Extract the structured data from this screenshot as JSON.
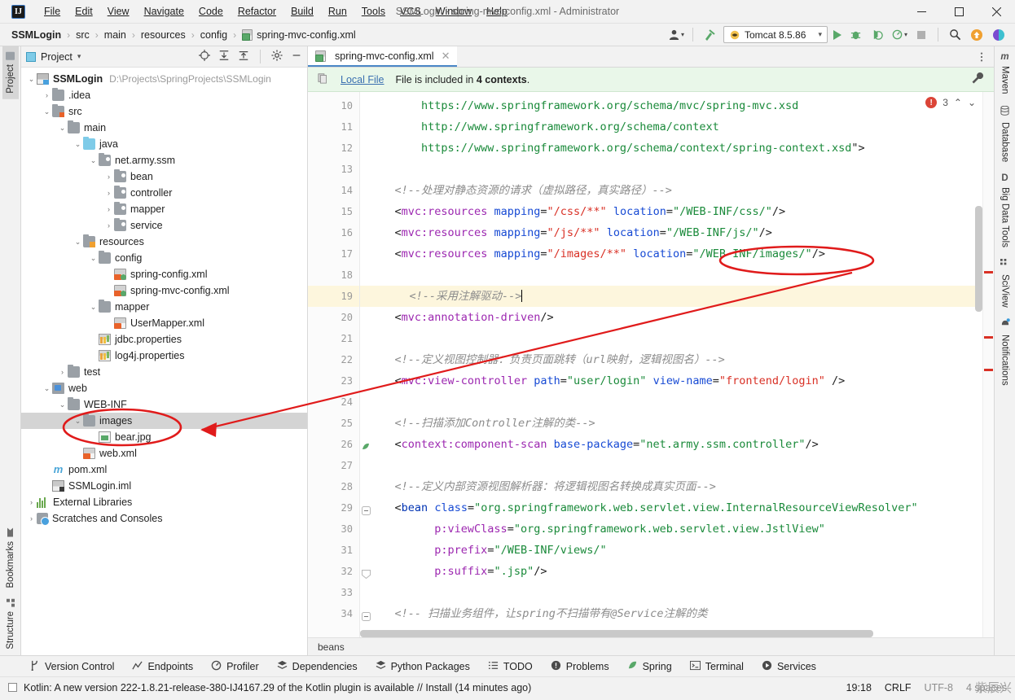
{
  "window": {
    "title": "SSMLogin - spring-mvc-config.xml - Administrator",
    "logo_text": "IJ",
    "minimize": "─",
    "maximize": "☐",
    "close": "✕"
  },
  "menu": {
    "items": [
      "File",
      "Edit",
      "View",
      "Navigate",
      "Code",
      "Refactor",
      "Build",
      "Run",
      "Tools",
      "VCS",
      "Window",
      "Help"
    ]
  },
  "navbar": {
    "crumbs": [
      "SSMLogin",
      "src",
      "main",
      "resources",
      "config",
      "spring-mvc-config.xml"
    ],
    "separator": "›",
    "run_config": "Tomcat 8.5.86",
    "caret": "▾"
  },
  "left_rail": {
    "top": [
      "Project"
    ],
    "bottom": [
      "Bookmarks",
      "Structure"
    ]
  },
  "right_rail": {
    "items": [
      "Maven",
      "Database",
      "Big Data Tools",
      "SciView",
      "Notifications"
    ]
  },
  "project": {
    "title": "Project",
    "caret": "▾",
    "tree": [
      {
        "depth": 0,
        "arrow": "⌄",
        "icon": "module-icon",
        "label": "SSMLogin",
        "bold": true,
        "path": "D:\\Projects\\SpringProjects\\SSMLogin"
      },
      {
        "depth": 1,
        "arrow": "›",
        "icon": "folder-icon",
        "label": ".idea"
      },
      {
        "depth": 1,
        "arrow": "⌄",
        "icon": "folder-source-icon",
        "label": "src"
      },
      {
        "depth": 2,
        "arrow": "⌄",
        "icon": "folder-icon",
        "label": "main"
      },
      {
        "depth": 3,
        "arrow": "⌄",
        "icon": "folder-java-icon",
        "label": "java"
      },
      {
        "depth": 4,
        "arrow": "⌄",
        "icon": "package-icon",
        "label": "net.army.ssm"
      },
      {
        "depth": 5,
        "arrow": "›",
        "icon": "package-icon",
        "label": "bean"
      },
      {
        "depth": 5,
        "arrow": "›",
        "icon": "package-icon",
        "label": "controller"
      },
      {
        "depth": 5,
        "arrow": "›",
        "icon": "package-icon",
        "label": "mapper"
      },
      {
        "depth": 5,
        "arrow": "›",
        "icon": "package-icon",
        "label": "service"
      },
      {
        "depth": 3,
        "arrow": "⌄",
        "icon": "folder-resources-icon",
        "label": "resources"
      },
      {
        "depth": 4,
        "arrow": "⌄",
        "icon": "folder-icon",
        "label": "config"
      },
      {
        "depth": 5,
        "arrow": "",
        "icon": "spring-xml-icon",
        "label": "spring-config.xml"
      },
      {
        "depth": 5,
        "arrow": "",
        "icon": "spring-xml-icon",
        "label": "spring-mvc-config.xml"
      },
      {
        "depth": 4,
        "arrow": "⌄",
        "icon": "folder-icon",
        "label": "mapper"
      },
      {
        "depth": 5,
        "arrow": "",
        "icon": "xml-icon",
        "label": "UserMapper.xml"
      },
      {
        "depth": 4,
        "arrow": "",
        "icon": "properties-icon",
        "label": "jdbc.properties"
      },
      {
        "depth": 4,
        "arrow": "",
        "icon": "properties-icon",
        "label": "log4j.properties"
      },
      {
        "depth": 2,
        "arrow": "›",
        "icon": "folder-icon",
        "label": "test"
      },
      {
        "depth": 1,
        "arrow": "⌄",
        "icon": "web-folder-icon",
        "label": "web"
      },
      {
        "depth": 2,
        "arrow": "⌄",
        "icon": "folder-icon",
        "label": "WEB-INF"
      },
      {
        "depth": 3,
        "arrow": "⌄",
        "icon": "folder-icon",
        "label": "images",
        "selected": true
      },
      {
        "depth": 4,
        "arrow": "",
        "icon": "image-file-icon",
        "label": "bear.jpg"
      },
      {
        "depth": 3,
        "arrow": "",
        "icon": "xml-icon",
        "label": "web.xml"
      },
      {
        "depth": 1,
        "arrow": "",
        "icon": "maven-icon",
        "label": "pom.xml"
      },
      {
        "depth": 1,
        "arrow": "",
        "icon": "iml-icon",
        "label": "SSMLogin.iml"
      },
      {
        "depth": 0,
        "arrow": "›",
        "icon": "libraries-icon",
        "label": "External Libraries"
      },
      {
        "depth": 0,
        "arrow": "›",
        "icon": "scratches-icon",
        "label": "Scratches and Consoles"
      }
    ]
  },
  "editor": {
    "tab_label": "spring-mvc-config.xml",
    "tab_close": "✕",
    "banner": {
      "link": "Local File",
      "text_before": "File is included in ",
      "bold": "4 contexts",
      "text_after": "."
    },
    "inspection": {
      "error_count": "3",
      "up": "⌃",
      "down": "⌄"
    },
    "breadcrumb": "beans",
    "first_line_number": 10,
    "lines": [
      {
        "n": 10,
        "tokens": [
          {
            "t": "        ",
            "c": "punct"
          },
          {
            "t": "https://www.springframework.org/schema/mvc/spring-mvc.xsd",
            "c": "str"
          }
        ]
      },
      {
        "n": 11,
        "tokens": [
          {
            "t": "        ",
            "c": "punct"
          },
          {
            "t": "http://www.springframework.org/schema/context",
            "c": "str"
          }
        ]
      },
      {
        "n": 12,
        "tokens": [
          {
            "t": "        ",
            "c": "punct"
          },
          {
            "t": "https://www.springframework.org/schema/context/spring-context.xsd",
            "c": "str"
          },
          {
            "t": "\">",
            "c": "punct"
          }
        ]
      },
      {
        "n": 13,
        "tokens": []
      },
      {
        "n": 14,
        "tokens": [
          {
            "t": "    ",
            "c": "punct"
          },
          {
            "t": "<!--处理对静态资源的请求（虚拟路径，真实路径）-->",
            "c": "com"
          }
        ]
      },
      {
        "n": 15,
        "tokens": [
          {
            "t": "    ",
            "c": "punct"
          },
          {
            "t": "<",
            "c": "punct"
          },
          {
            "t": "mvc:resources",
            "c": "tagp"
          },
          {
            "t": " ",
            "c": "punct"
          },
          {
            "t": "mapping",
            "c": "attr"
          },
          {
            "t": "=",
            "c": "punct"
          },
          {
            "t": "\"/css/**\"",
            "c": "strr"
          },
          {
            "t": " ",
            "c": "punct"
          },
          {
            "t": "location",
            "c": "attr"
          },
          {
            "t": "=",
            "c": "punct"
          },
          {
            "t": "\"/WEB-INF/css/\"",
            "c": "str"
          },
          {
            "t": "/>",
            "c": "punct"
          }
        ]
      },
      {
        "n": 16,
        "tokens": [
          {
            "t": "    ",
            "c": "punct"
          },
          {
            "t": "<",
            "c": "punct"
          },
          {
            "t": "mvc:resources",
            "c": "tagp"
          },
          {
            "t": " ",
            "c": "punct"
          },
          {
            "t": "mapping",
            "c": "attr"
          },
          {
            "t": "=",
            "c": "punct"
          },
          {
            "t": "\"/js/**\"",
            "c": "strr"
          },
          {
            "t": " ",
            "c": "punct"
          },
          {
            "t": "location",
            "c": "attr"
          },
          {
            "t": "=",
            "c": "punct"
          },
          {
            "t": "\"/WEB-INF/js/\"",
            "c": "str"
          },
          {
            "t": "/>",
            "c": "punct"
          }
        ]
      },
      {
        "n": 17,
        "tokens": [
          {
            "t": "    ",
            "c": "punct"
          },
          {
            "t": "<",
            "c": "punct"
          },
          {
            "t": "mvc:resources",
            "c": "tagp"
          },
          {
            "t": " ",
            "c": "punct"
          },
          {
            "t": "mapping",
            "c": "attr"
          },
          {
            "t": "=",
            "c": "punct"
          },
          {
            "t": "\"/images/**\"",
            "c": "strr"
          },
          {
            "t": " ",
            "c": "punct"
          },
          {
            "t": "location",
            "c": "attr"
          },
          {
            "t": "=",
            "c": "punct"
          },
          {
            "t": "\"/WEB-INF/images/\"",
            "c": "str"
          },
          {
            "t": "/>",
            "c": "punct"
          }
        ]
      },
      {
        "n": 18,
        "tokens": []
      },
      {
        "n": 19,
        "highlight": true,
        "bulb": true,
        "caret": true,
        "tokens": [
          {
            "t": "    ",
            "c": "punct"
          },
          {
            "t": "<!--采用注解驱动-->",
            "c": "com"
          }
        ]
      },
      {
        "n": 20,
        "tokens": [
          {
            "t": "    ",
            "c": "punct"
          },
          {
            "t": "<",
            "c": "punct"
          },
          {
            "t": "mvc:annotation-driven",
            "c": "tagp"
          },
          {
            "t": "/>",
            "c": "punct"
          }
        ]
      },
      {
        "n": 21,
        "tokens": []
      },
      {
        "n": 22,
        "tokens": [
          {
            "t": "    ",
            "c": "punct"
          },
          {
            "t": "<!--定义视图控制器：负责页面跳转（url映射，逻辑视图名）-->",
            "c": "com"
          }
        ]
      },
      {
        "n": 23,
        "tokens": [
          {
            "t": "    ",
            "c": "punct"
          },
          {
            "t": "<",
            "c": "punct"
          },
          {
            "t": "mvc:view-controller",
            "c": "tagp"
          },
          {
            "t": " ",
            "c": "punct"
          },
          {
            "t": "path",
            "c": "attr"
          },
          {
            "t": "=",
            "c": "punct"
          },
          {
            "t": "\"user/login\"",
            "c": "str"
          },
          {
            "t": " ",
            "c": "punct"
          },
          {
            "t": "view-name",
            "c": "attr"
          },
          {
            "t": "=",
            "c": "punct"
          },
          {
            "t": "\"frontend/login\"",
            "c": "strr"
          },
          {
            "t": " />",
            "c": "punct"
          }
        ]
      },
      {
        "n": 24,
        "tokens": []
      },
      {
        "n": 25,
        "tokens": [
          {
            "t": "    ",
            "c": "punct"
          },
          {
            "t": "<!--扫描添加Controller注解的类-->",
            "c": "com"
          }
        ]
      },
      {
        "n": 26,
        "marker": "spring",
        "tokens": [
          {
            "t": "    ",
            "c": "punct"
          },
          {
            "t": "<",
            "c": "punct"
          },
          {
            "t": "context:component-scan",
            "c": "tagp"
          },
          {
            "t": " ",
            "c": "punct"
          },
          {
            "t": "base-package",
            "c": "attr"
          },
          {
            "t": "=",
            "c": "punct"
          },
          {
            "t": "\"net.army.ssm.controller\"",
            "c": "str"
          },
          {
            "t": "/>",
            "c": "punct"
          }
        ]
      },
      {
        "n": 27,
        "tokens": []
      },
      {
        "n": 28,
        "tokens": [
          {
            "t": "    ",
            "c": "punct"
          },
          {
            "t": "<!--定义内部资源视图解析器：将逻辑视图名转换成真实页面-->",
            "c": "com"
          }
        ]
      },
      {
        "n": 29,
        "fold": "open",
        "tokens": [
          {
            "t": "    ",
            "c": "punct"
          },
          {
            "t": "<",
            "c": "punct"
          },
          {
            "t": "bean",
            "c": "tagn"
          },
          {
            "t": " ",
            "c": "punct"
          },
          {
            "t": "class",
            "c": "attr"
          },
          {
            "t": "=",
            "c": "punct"
          },
          {
            "t": "\"org.springframework.web.servlet.view.InternalResourceViewResolver\"",
            "c": "str"
          }
        ]
      },
      {
        "n": 30,
        "tokens": [
          {
            "t": "          ",
            "c": "punct"
          },
          {
            "t": "p:viewClass",
            "c": "tagp"
          },
          {
            "t": "=",
            "c": "punct"
          },
          {
            "t": "\"org.springframework.web.servlet.view.JstlView\"",
            "c": "str"
          }
        ]
      },
      {
        "n": 31,
        "tokens": [
          {
            "t": "          ",
            "c": "punct"
          },
          {
            "t": "p:prefix",
            "c": "tagp"
          },
          {
            "t": "=",
            "c": "punct"
          },
          {
            "t": "\"/WEB-INF/views/\"",
            "c": "str"
          }
        ]
      },
      {
        "n": 32,
        "fold": "close",
        "tokens": [
          {
            "t": "          ",
            "c": "punct"
          },
          {
            "t": "p:suffix",
            "c": "tagp"
          },
          {
            "t": "=",
            "c": "punct"
          },
          {
            "t": "\".jsp\"",
            "c": "str"
          },
          {
            "t": "/>",
            "c": "punct"
          }
        ]
      },
      {
        "n": 33,
        "tokens": []
      },
      {
        "n": 34,
        "fold": "open",
        "tokens": [
          {
            "t": "    ",
            "c": "punct"
          },
          {
            "t": "<!-- 扫描业务组件，让spring不扫描带有@Service注解的类",
            "c": "com"
          }
        ]
      }
    ]
  },
  "bottom_toolbar": {
    "items": [
      {
        "label": "Version Control",
        "icon": "branch-icon"
      },
      {
        "label": "Endpoints",
        "icon": "endpoints-icon"
      },
      {
        "label": "Profiler",
        "icon": "profiler-icon"
      },
      {
        "label": "Dependencies",
        "icon": "dependencies-icon"
      },
      {
        "label": "Python Packages",
        "icon": "python-packages-icon"
      },
      {
        "label": "TODO",
        "icon": "todo-icon"
      },
      {
        "label": "Problems",
        "icon": "problems-icon"
      },
      {
        "label": "Spring",
        "icon": "spring-icon"
      },
      {
        "label": "Terminal",
        "icon": "terminal-icon"
      },
      {
        "label": "Services",
        "icon": "services-icon"
      }
    ]
  },
  "statusbar": {
    "message": "Kotlin: A new version 222-1.8.21-release-380-IJ4167.29 of the Kotlin plugin is available // Install (14 minutes ago)",
    "position": "19:18",
    "line_separator": "CRLF",
    "encoding": "UTF-8",
    "indent": "4 spaces",
    "watermark": "紫辰兴"
  },
  "annotations": {
    "color": "#e01b1b",
    "ellipse_code_label": "location=\"/WEB-INF/images/\"",
    "ellipse_tree_label": "images / bear.jpg",
    "arrow_label": "arrow-from-code-to-tree"
  }
}
